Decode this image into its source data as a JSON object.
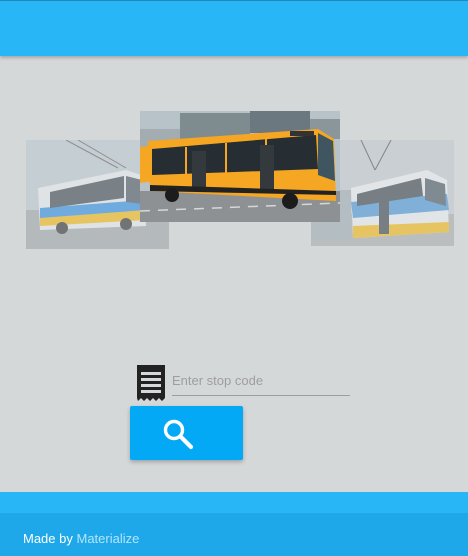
{
  "carousel": {
    "slides": [
      {
        "name": "trolleybus-photo",
        "position": "left"
      },
      {
        "name": "bus-photo",
        "position": "center",
        "active": true
      },
      {
        "name": "tram-photo",
        "position": "right"
      }
    ]
  },
  "search": {
    "icon": "ticket-icon",
    "placeholder": "Enter stop code",
    "value": "",
    "button_icon": "search-icon"
  },
  "footer": {
    "made_by": "Made by",
    "link_label": "Materialize"
  },
  "colors": {
    "primary": "#29b6f6",
    "accent": "#03a9f4",
    "background": "#d5d8d9",
    "bus_yellow": "#f5a623"
  }
}
